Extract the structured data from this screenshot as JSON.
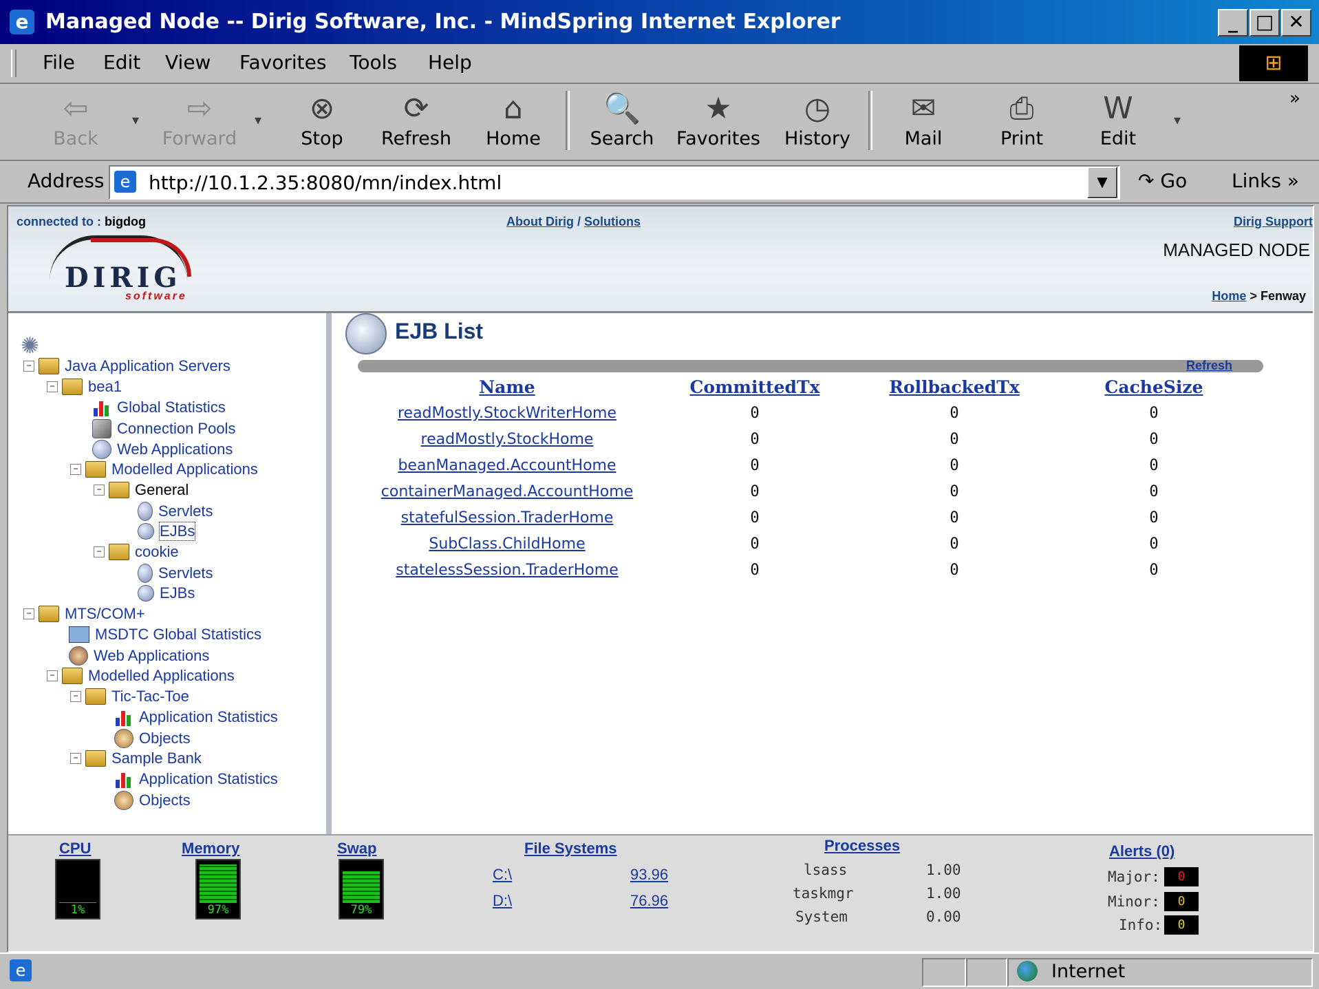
{
  "window": {
    "title": "Managed Node -- Dirig Software, Inc. - MindSpring Internet Explorer"
  },
  "menu": [
    "File",
    "Edit",
    "View",
    "Favorites",
    "Tools",
    "Help"
  ],
  "toolbar": {
    "back": "Back",
    "forward": "Forward",
    "stop": "Stop",
    "refresh": "Refresh",
    "home": "Home",
    "search": "Search",
    "favorites": "Favorites",
    "history": "History",
    "mail": "Mail",
    "print": "Print",
    "edit": "Edit",
    "more": "»"
  },
  "address": {
    "label": "Address",
    "url": "http://10.1.2.35:8080/mn/index.html",
    "go": "Go",
    "links": "Links »"
  },
  "header": {
    "connected_label": "connected to :",
    "connected_host": "bigdog",
    "about": "About Dirig",
    "slash": "/",
    "solutions": "Solutions",
    "support": "Dirig Support",
    "logo_word": "DIRIG",
    "logo_sub": "software",
    "section": "MANAGED NODE",
    "crumb_home": "Home",
    "crumb_sep": ">",
    "crumb_current": "Fenway"
  },
  "tree": {
    "java_servers": "Java Application Servers",
    "bea1": "bea1",
    "global_stats": "Global Statistics",
    "conn_pools": "Connection Pools",
    "web_apps": "Web Applications",
    "modelled_apps": "Modelled Applications",
    "general": "General",
    "general_servlets": "Servlets",
    "general_ejbs": "EJBs",
    "cookie": "cookie",
    "cookie_servlets": "Servlets",
    "cookie_ejbs": "EJBs",
    "mts": "MTS/COM+",
    "msdtc": "MSDTC Global Statistics",
    "mts_web_apps": "Web Applications",
    "mts_modelled": "Modelled Applications",
    "tictactoe": "Tic-Tac-Toe",
    "ttt_stats": "Application Statistics",
    "ttt_objects": "Objects",
    "sample_bank": "Sample Bank",
    "sb_stats": "Application Statistics",
    "sb_objects": "Objects"
  },
  "ejb_list": {
    "title": "EJB List",
    "refresh": "Refresh",
    "columns": [
      "Name",
      "CommittedTx",
      "RollbackedTx",
      "CacheSize"
    ],
    "rows": [
      [
        "readMostly.StockWriterHome",
        "0",
        "0",
        "0"
      ],
      [
        "readMostly.StockHome",
        "0",
        "0",
        "0"
      ],
      [
        "beanManaged.AccountHome",
        "0",
        "0",
        "0"
      ],
      [
        "containerManaged.AccountHome",
        "0",
        "0",
        "0"
      ],
      [
        "statefulSession.TraderHome",
        "0",
        "0",
        "0"
      ],
      [
        "SubClass.ChildHome",
        "0",
        "0",
        "0"
      ],
      [
        "statelessSession.TraderHome",
        "0",
        "0",
        "0"
      ]
    ]
  },
  "footer": {
    "cpu": {
      "label": "CPU",
      "value": "1%",
      "level": 0.01
    },
    "memory": {
      "label": "Memory",
      "value": "97%",
      "level": 0.97
    },
    "swap": {
      "label": "Swap",
      "value": "79%",
      "level": 0.79
    },
    "fs_label": "File Systems",
    "fs": [
      {
        "drive": "C:\\",
        "value": "93.96"
      },
      {
        "drive": "D:\\",
        "value": "76.96"
      }
    ],
    "proc_label": "Processes",
    "processes": [
      {
        "name": "lsass",
        "value": "1.00"
      },
      {
        "name": "taskmgr",
        "value": "1.00"
      },
      {
        "name": "System",
        "value": "0.00"
      }
    ],
    "alerts_label": "Alerts (0)",
    "alerts": [
      {
        "label": "Major:",
        "value": "0",
        "color": "#e02020"
      },
      {
        "label": "Minor:",
        "value": "0",
        "color": "#e0c020"
      },
      {
        "label": "Info:",
        "value": "0",
        "color": "#e0d020"
      }
    ]
  },
  "status": {
    "zone": "Internet"
  }
}
